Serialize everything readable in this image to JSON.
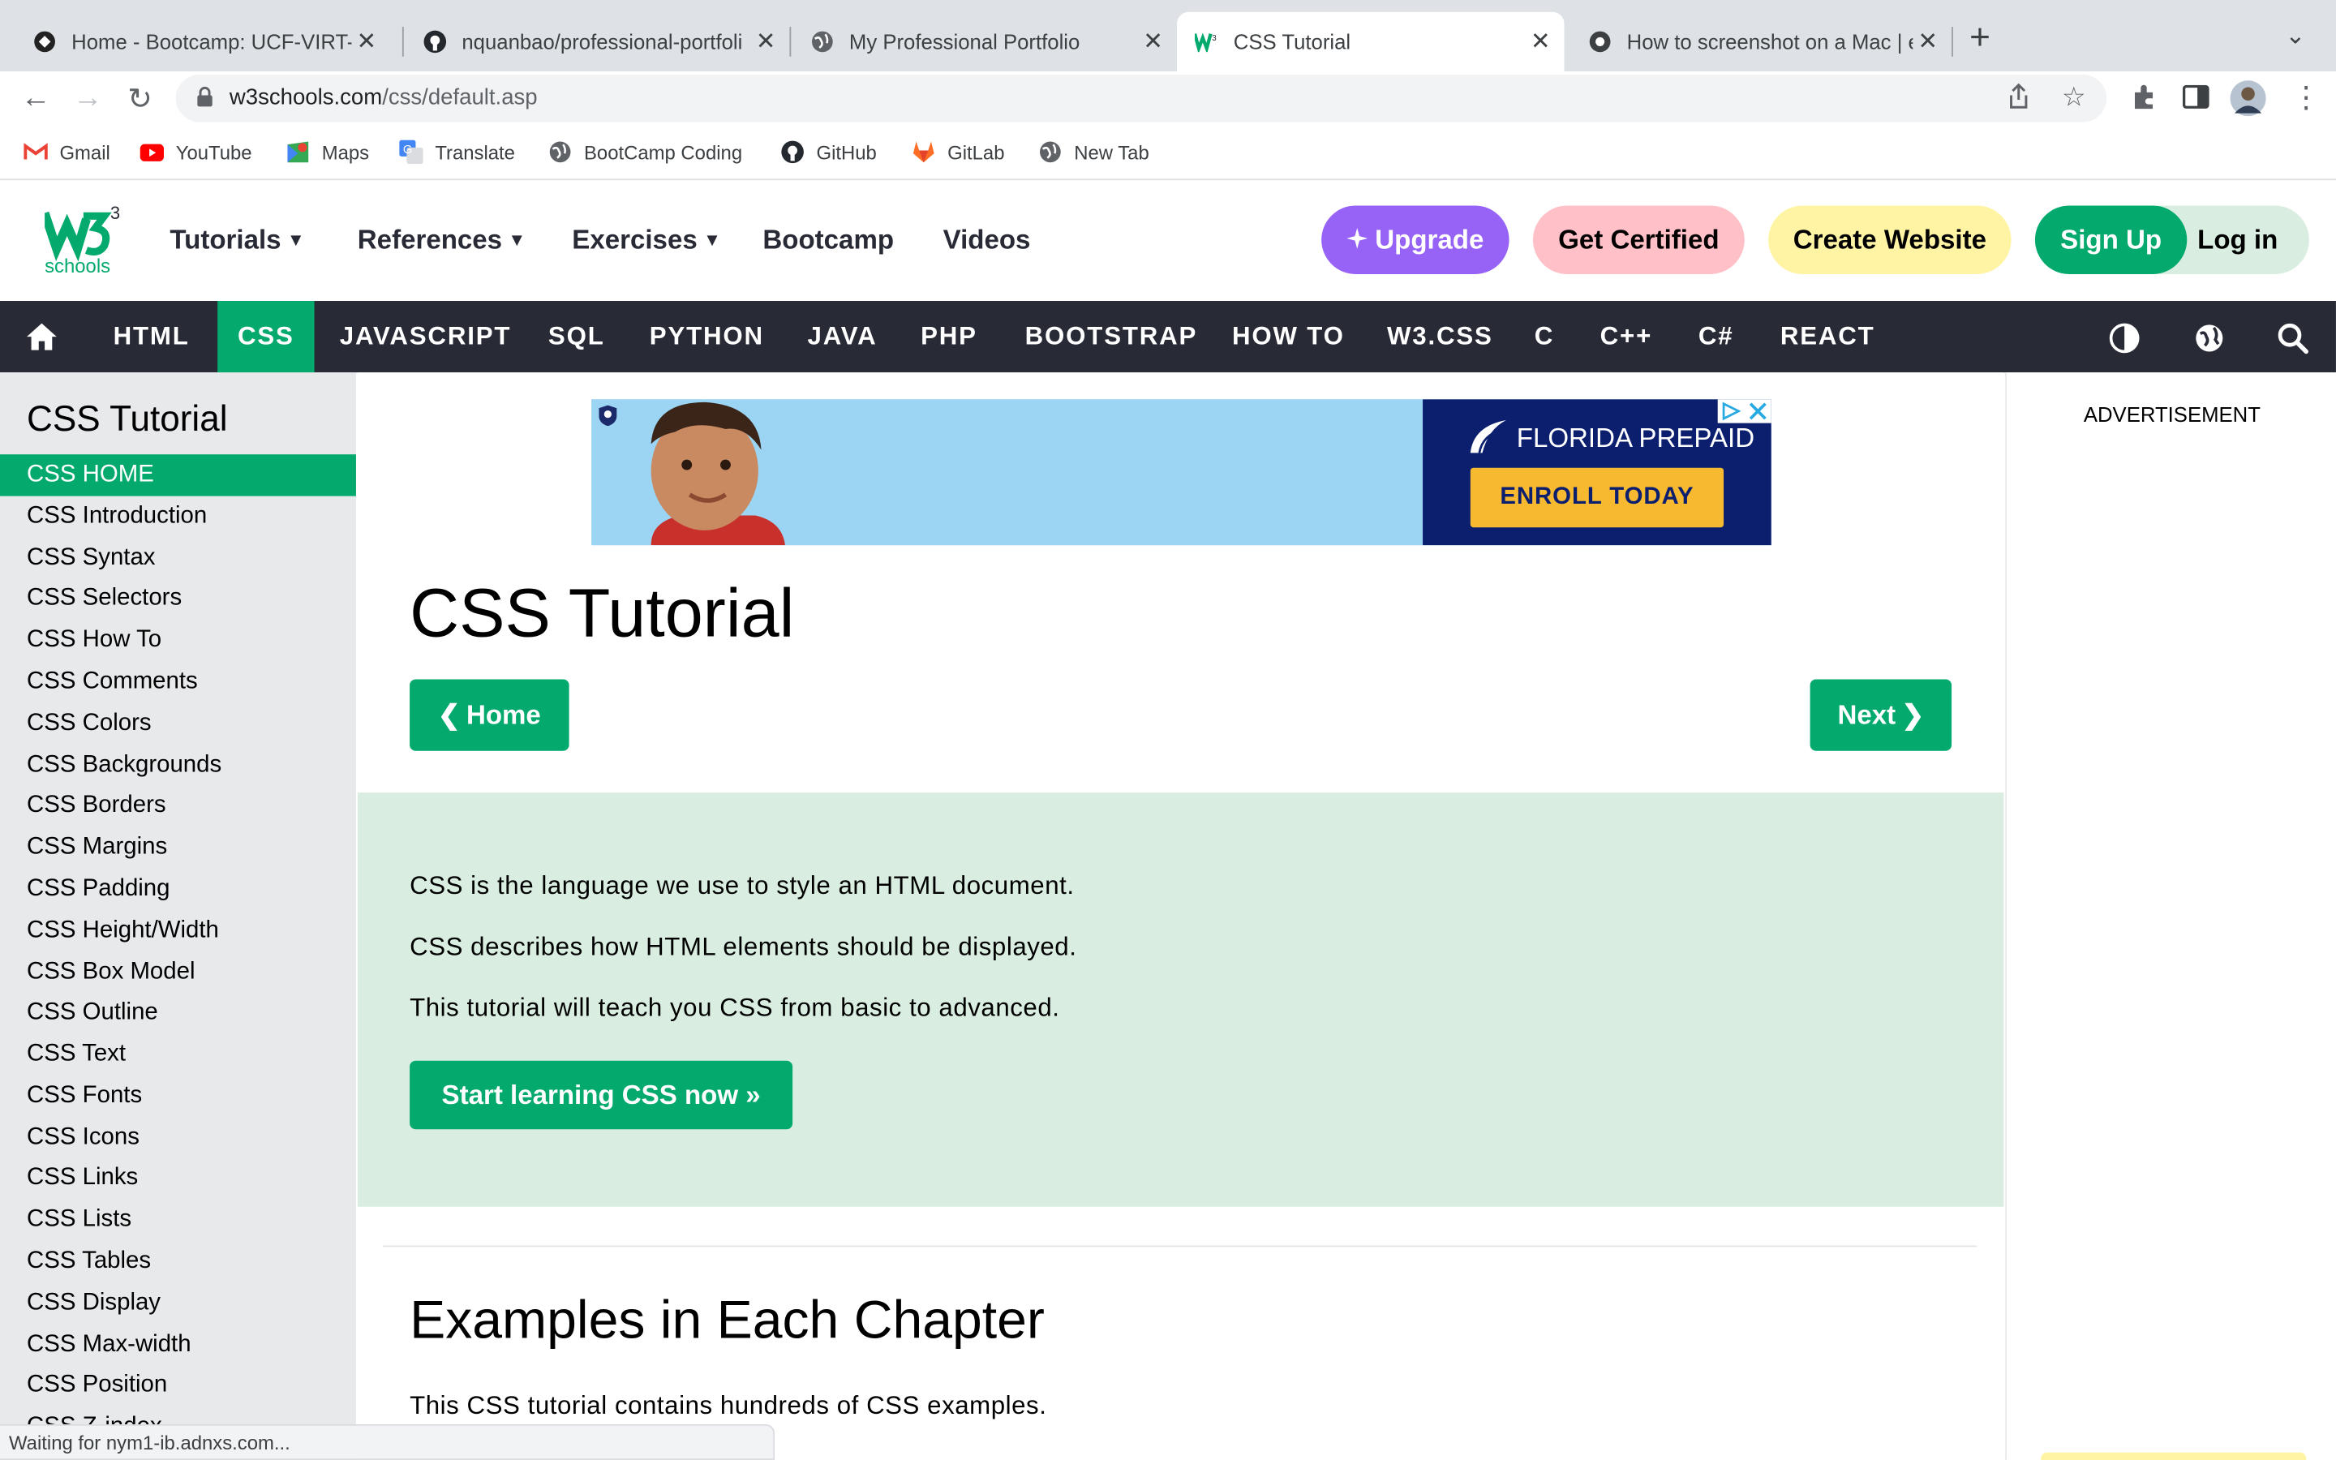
{
  "browser": {
    "tabs": [
      {
        "title": "Home - Bootcamp: UCF-VIRT-F",
        "icon": "bootcamp-favicon"
      },
      {
        "title": "nquanbao/professional-portfoli",
        "icon": "github-icon"
      },
      {
        "title": "My Professional Portfolio",
        "icon": "globe-icon"
      },
      {
        "title": "CSS Tutorial",
        "icon": "w3schools-favicon"
      },
      {
        "title": "How to screenshot on a Mac | e",
        "icon": "screenshot-favicon"
      }
    ],
    "url_host": "w3schools.com",
    "url_path": "/css/default.asp",
    "bookmarks": [
      {
        "label": "Gmail",
        "icon": "gmail-icon"
      },
      {
        "label": "YouTube",
        "icon": "youtube-icon"
      },
      {
        "label": "Maps",
        "icon": "maps-icon"
      },
      {
        "label": "Translate",
        "icon": "translate-icon"
      },
      {
        "label": "BootCamp Coding",
        "icon": "globe-icon"
      },
      {
        "label": "GitHub",
        "icon": "github-icon"
      },
      {
        "label": "GitLab",
        "icon": "gitlab-icon"
      },
      {
        "label": "New Tab",
        "icon": "globe-icon"
      }
    ],
    "status_text": "Waiting for nym1-ib.adnxs.com..."
  },
  "header": {
    "logo_text": "schools",
    "logo_sup": "3",
    "menus": [
      "Tutorials",
      "References",
      "Exercises",
      "Bootcamp",
      "Videos"
    ],
    "upgrade": "Upgrade",
    "get_certified": "Get Certified",
    "create_website": "Create Website",
    "sign_up": "Sign Up",
    "log_in": "Log in"
  },
  "topnav": [
    "HTML",
    "CSS",
    "JAVASCRIPT",
    "SQL",
    "PYTHON",
    "JAVA",
    "PHP",
    "BOOTSTRAP",
    "HOW TO",
    "W3.CSS",
    "C",
    "C++",
    "C#",
    "REACT"
  ],
  "sidebar": {
    "title": "CSS Tutorial",
    "items": [
      "CSS HOME",
      "CSS Introduction",
      "CSS Syntax",
      "CSS Selectors",
      "CSS How To",
      "CSS Comments",
      "CSS Colors",
      "CSS Backgrounds",
      "CSS Borders",
      "CSS Margins",
      "CSS Padding",
      "CSS Height/Width",
      "CSS Box Model",
      "CSS Outline",
      "CSS Text",
      "CSS Fonts",
      "CSS Icons",
      "CSS Links",
      "CSS Lists",
      "CSS Tables",
      "CSS Display",
      "CSS Max-width",
      "CSS Position",
      "CSS Z-index"
    ]
  },
  "ad": {
    "brand": "FLORIDA PREPAID",
    "cta": "ENROLL TODAY"
  },
  "main": {
    "title": "CSS Tutorial",
    "home_button": "Home",
    "next_button": "Next",
    "intro": [
      "CSS is the language we use to style an HTML document.",
      "CSS describes how HTML elements should be displayed.",
      "This tutorial will teach you CSS from basic to advanced."
    ],
    "start_button": "Start learning CSS now »",
    "section_title": "Examples in Each Chapter",
    "section_text": "This CSS tutorial contains hundreds of CSS examples."
  },
  "right": {
    "ad_label": "ADVERTISEMENT"
  },
  "colors": {
    "w3_green": "#04aa6d",
    "nav_dark": "#282a35",
    "upgrade_purple": "#9763f6",
    "certified_pink": "#ffc0c7",
    "create_yellow": "#fff4a3",
    "login_green": "#d9eee1",
    "intro_bg": "#d9eee1",
    "sidebar_bg": "#e7e9eb"
  }
}
